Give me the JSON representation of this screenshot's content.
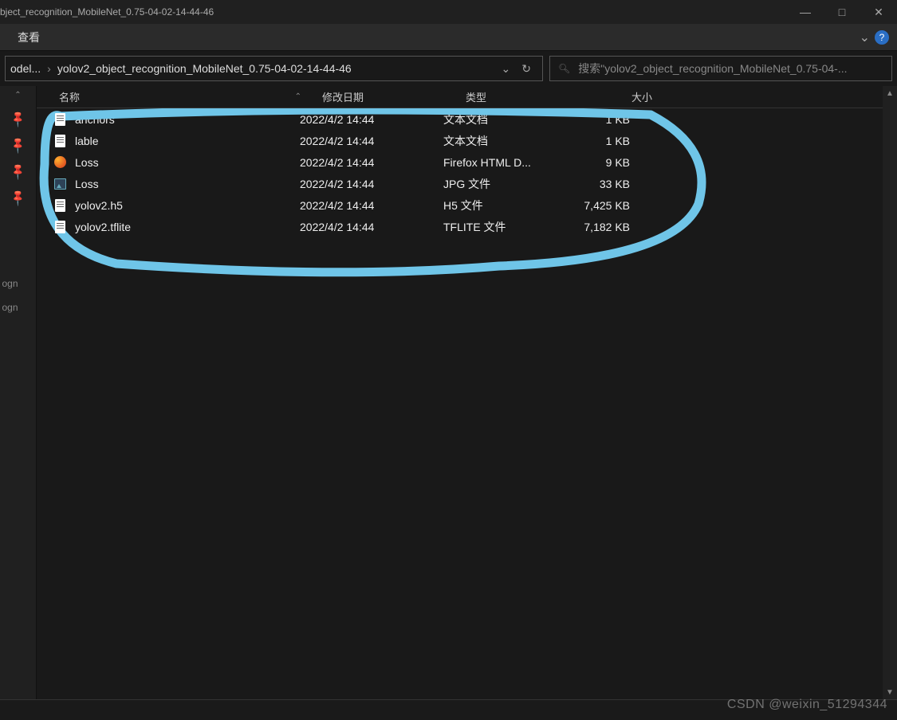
{
  "window": {
    "title": "bject_recognition_MobileNet_0.75-04-02-14-44-46",
    "minimize": "—",
    "maximize": "□",
    "close": "✕"
  },
  "menu": {
    "view": "查看",
    "expand": "⌄",
    "help": "?"
  },
  "breadcrumb": {
    "seg1": "odel...",
    "seg2": "yolov2_object_recognition_MobileNet_0.75-04-02-14-44-46",
    "dropdown": "⌄",
    "refresh": "↻"
  },
  "search": {
    "icon": "🔍",
    "placeholder": "搜索\"yolov2_object_recognition_MobileNet_0.75-04-..."
  },
  "sidebar": {
    "up": "⌃",
    "label1": "ogn",
    "label2": "ogn"
  },
  "columns": {
    "name": "名称",
    "date": "修改日期",
    "type": "类型",
    "size": "大小",
    "sort": "⌃"
  },
  "files": [
    {
      "icon": "doc",
      "name": "anchors",
      "date": "2022/4/2 14:44",
      "type": "文本文档",
      "size": "1 KB"
    },
    {
      "icon": "doc",
      "name": "lable",
      "date": "2022/4/2 14:44",
      "type": "文本文档",
      "size": "1 KB"
    },
    {
      "icon": "ff",
      "name": "Loss",
      "date": "2022/4/2 14:44",
      "type": "Firefox HTML D...",
      "size": "9 KB"
    },
    {
      "icon": "jpg",
      "name": "Loss",
      "date": "2022/4/2 14:44",
      "type": "JPG 文件",
      "size": "33 KB"
    },
    {
      "icon": "doc",
      "name": "yolov2.h5",
      "date": "2022/4/2 14:44",
      "type": "H5 文件",
      "size": "7,425 KB"
    },
    {
      "icon": "doc",
      "name": "yolov2.tflite",
      "date": "2022/4/2 14:44",
      "type": "TFLITE 文件",
      "size": "7,182 KB"
    }
  ],
  "watermark": "CSDN @weixin_51294344"
}
